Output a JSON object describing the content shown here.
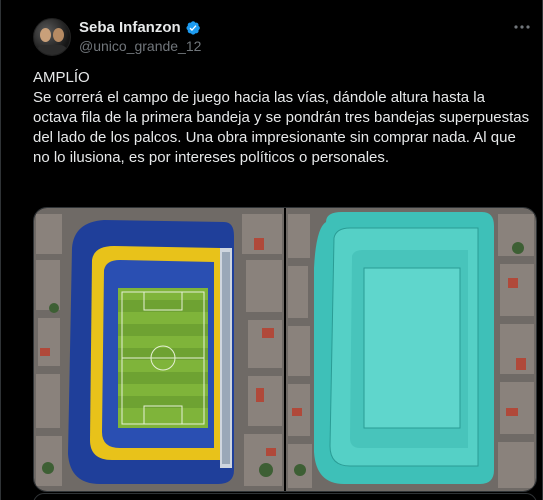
{
  "author": {
    "display_name": "Seba Infanzon",
    "handle": "@unico_grande_12",
    "verified": true,
    "avatar_icon": "avatar-photo"
  },
  "more_icon": "more-options-icon",
  "tweet": {
    "text": "AMPLÍO\nSe correrá el campo de juego hacia las vías, dándole altura hasta la octava fila de la primera bandeja y se pondrán tres bandejas superpuestas del lado de los palcos. Una obra impresionante sin comprar nada. Al que no lo ilusiona, es por intereses políticos o personales."
  },
  "media": [
    {
      "name": "stadium-aerial-photo",
      "description_icon": "stadium-photo-icon"
    },
    {
      "name": "stadium-renovation-render",
      "description_icon": "stadium-render-icon"
    }
  ],
  "colors": {
    "background": "#000000",
    "text": "#e7e9ea",
    "muted": "#71767b",
    "verified": "#1d9bf0",
    "stadium_blue": "#1f3f9a",
    "stadium_yellow": "#e8c21a",
    "pitch_green": "#7fb43a",
    "render_teal": "#3ec0b8"
  }
}
